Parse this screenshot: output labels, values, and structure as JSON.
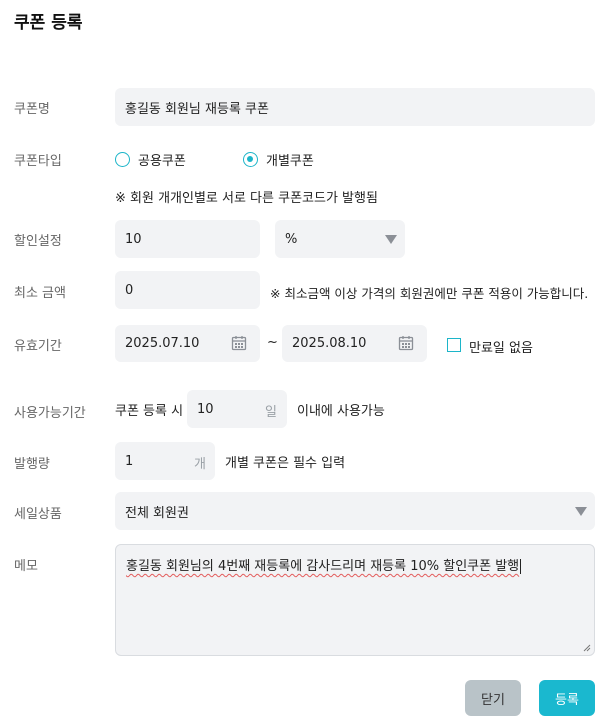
{
  "dialog": {
    "title": "쿠폰 등록"
  },
  "coupon_name": {
    "label": "쿠폰명",
    "value": "홍길동 회원님 재등록 쿠폰"
  },
  "coupon_type": {
    "label": "쿠폰타입",
    "options": [
      {
        "label": "공용쿠폰",
        "selected": false
      },
      {
        "label": "개별쿠폰",
        "selected": true
      }
    ],
    "note": "※ 회원 개개인별로 서로 다른 쿠폰코드가 발행됨"
  },
  "discount": {
    "label": "할인설정",
    "value": "10",
    "unit_selected": "%"
  },
  "min_amount": {
    "label": "최소 금액",
    "value": "0",
    "note": "※ 최소금액 이상 가격의 회원권에만 쿠폰 적용이 가능합니다."
  },
  "validity": {
    "label": "유효기간",
    "start": "2025.07.10",
    "separator": "~",
    "end": "2025.08.10",
    "no_expiry_label": "만료일 없음",
    "no_expiry_checked": false
  },
  "usable_period": {
    "label": "사용가능기간",
    "prefix": "쿠폰 등록 시",
    "value": "10",
    "unit": "일",
    "suffix": "이내에 사용가능"
  },
  "issue_count": {
    "label": "발행량",
    "value": "1",
    "unit": "개",
    "note": "개별 쿠폰은 필수 입력"
  },
  "sale_product": {
    "label": "세일상품",
    "value": "전체 회원권"
  },
  "memo": {
    "label": "메모",
    "value": "홍길동 회원님의 4번째 재등록에 감사드리며 재등록 10% 할인쿠폰 발행"
  },
  "buttons": {
    "close": "닫기",
    "register": "등록"
  },
  "colors": {
    "accent": "#1ab8cf",
    "field_bg": "#f2f3f5",
    "close_button": "#b9c3c8"
  }
}
